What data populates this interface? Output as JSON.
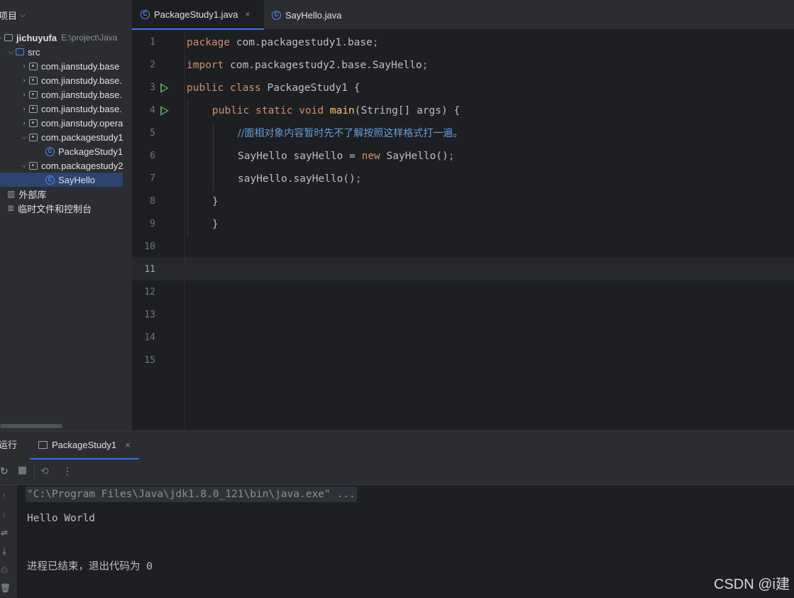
{
  "project": {
    "title": "项目",
    "root": {
      "name": "jichuyufa",
      "path": "E:\\project\\Java"
    },
    "src": "src",
    "packages": [
      {
        "label": "com.jianstudy.base"
      },
      {
        "label": "com.jianstudy.base."
      },
      {
        "label": "com.jianstudy.base."
      },
      {
        "label": "com.jianstudy.base."
      },
      {
        "label": "com.jianstudy.opera"
      },
      {
        "label": "com.packagestudy1"
      },
      {
        "label": "com.packagestudy2"
      }
    ],
    "classes": [
      {
        "label": "PackageStudy1"
      },
      {
        "label": "SayHello"
      }
    ],
    "external_libs": "外部库",
    "scratches": "临时文件和控制台"
  },
  "editor": {
    "tabs": [
      {
        "label": "PackageStudy1.java",
        "active": true,
        "close": "×"
      },
      {
        "label": "SayHello.java",
        "active": false
      }
    ],
    "line_numbers": [
      "1",
      "2",
      "3",
      "4",
      "5",
      "6",
      "7",
      "8",
      "9",
      "10",
      "11",
      "12",
      "13",
      "14",
      "15"
    ],
    "current_line": "11",
    "code": {
      "l1_kw": "package",
      "l1_rest": " com.packagestudy1.base",
      "l1_semi": ";",
      "l2_kw": "import",
      "l2_rest": " com.packagestudy2.base.SayHello",
      "l2_semi": ";",
      "l3_kw": "public class",
      "l3_rest": " PackageStudy1 {",
      "l4_kw": "public static void",
      "l4_mth": " main",
      "l4_rest": "(String[] args) {",
      "l5_comment": "//面相对象内容暂时先不了解按照这样格式打一遍。",
      "l6_a": "SayHello sayHello = ",
      "l6_kw": "new",
      "l6_b": " SayHello()",
      "l6_semi": ";",
      "l7_a": "sayHello.sayHello()",
      "l7_semi": ";",
      "l8": "}",
      "l9": "}"
    }
  },
  "run": {
    "title": "运行",
    "tab_label": "PackageStudy1",
    "tab_close": "×",
    "console": [
      "\"C:\\Program Files\\Java\\jdk1.8.0_121\\bin\\java.exe\" ...",
      "Hello World",
      "进程已结束，退出代码为 0"
    ]
  },
  "watermark": "CSDN @i建",
  "colors": {
    "keyword": "#cf8e6d",
    "method": "#ffc66d",
    "comment": "#5f9ed8",
    "run_icon": "#57965c",
    "class_icon": "#548af7",
    "selection": "#2e436e"
  },
  "icons": [
    "chevron-down-icon",
    "project-module-icon",
    "folder-icon",
    "package-icon",
    "class-icon",
    "library-icon",
    "scratches-icon",
    "run-gutter-icon",
    "rerun-icon",
    "stop-icon",
    "debug-icon",
    "more-icon",
    "up-icon",
    "down-icon",
    "wrap-icon",
    "scroll-end-icon",
    "print-icon",
    "trash-icon",
    "console-icon",
    "close-icon"
  ]
}
